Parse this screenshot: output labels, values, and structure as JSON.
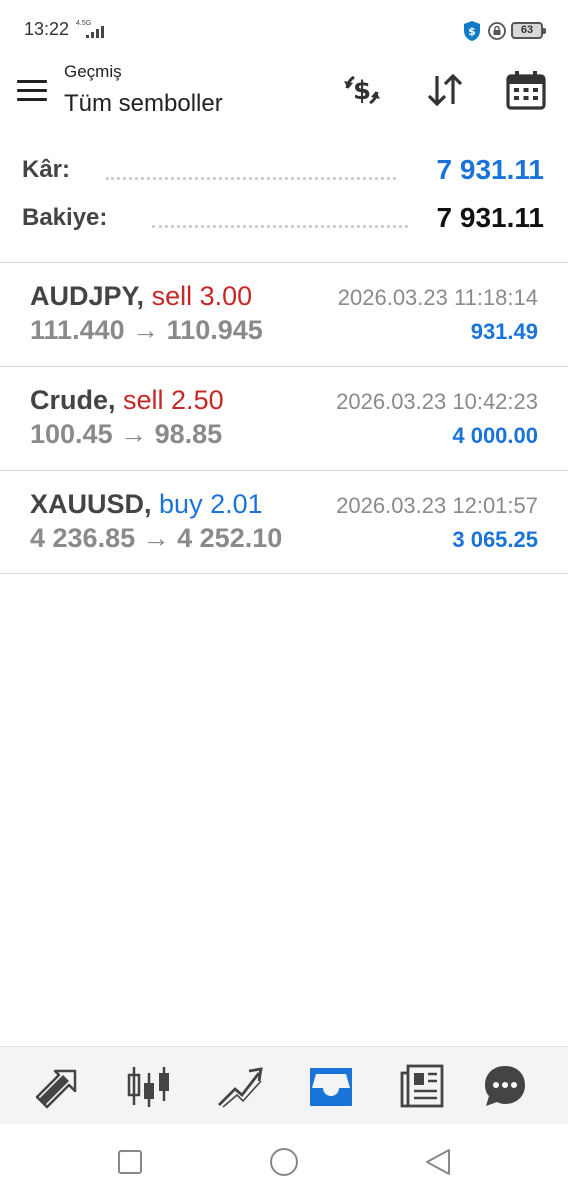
{
  "status_bar": {
    "time": "13:22",
    "network": "4.5G",
    "battery": "63"
  },
  "header": {
    "subtitle": "Geçmiş",
    "title": "Tüm semboller"
  },
  "summary": {
    "profit_label": "Kâr:",
    "profit_value": "7 931.11",
    "balance_label": "Bakiye:",
    "balance_value": "7 931.11"
  },
  "colors": {
    "sell": "#c62828",
    "buy": "#1a73d9",
    "profit": "#1a73d9",
    "accent": "#1a73d9"
  },
  "deals": [
    {
      "symbol": "AUDJPY,",
      "side": "sell 3.00",
      "type": "sell",
      "time": "2026.03.23 11:18:14",
      "open_price": "111.440",
      "close_price": "110.945",
      "profit": "931.49"
    },
    {
      "symbol": "Crude,",
      "side": "sell 2.50",
      "type": "sell",
      "time": "2026.03.23 10:42:23",
      "open_price": "100.45",
      "close_price": "98.85",
      "profit": "4 000.00"
    },
    {
      "symbol": "XAUUSD,",
      "side": "buy 2.01",
      "type": "buy",
      "time": "2026.03.23 12:01:57",
      "open_price": "4 236.85",
      "close_price": "4 252.10",
      "profit": "3 065.25"
    }
  ],
  "arrow_glyph": "→",
  "toolbar_icons": [
    "currency-exchange-icon",
    "sort-icon",
    "calendar-icon"
  ],
  "bottom_nav": [
    {
      "icon": "trade-arrows-icon",
      "active": false
    },
    {
      "icon": "candlestick-chart-icon",
      "active": false
    },
    {
      "icon": "trend-lines-icon",
      "active": false
    },
    {
      "icon": "history-inbox-icon",
      "active": true
    },
    {
      "icon": "news-icon",
      "active": false
    },
    {
      "icon": "chat-icon",
      "active": false
    }
  ],
  "system_nav": [
    "recent-apps-icon",
    "home-icon",
    "back-icon"
  ]
}
